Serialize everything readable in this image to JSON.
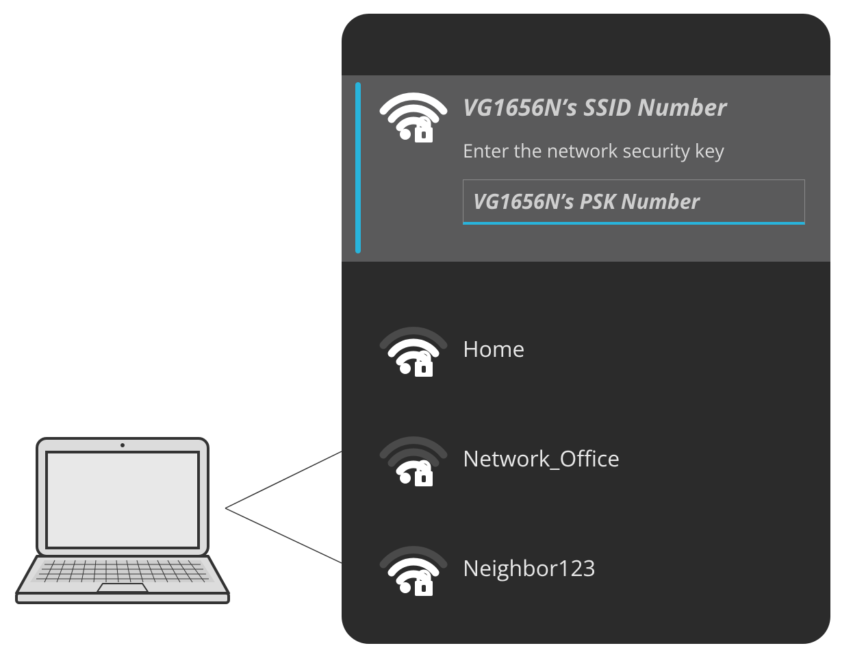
{
  "colors": {
    "panel_bg": "#2b2b2b",
    "selected_bg": "#5a5a5b",
    "accent": "#28b4dc",
    "text_light": "#e8e8e8",
    "text_dim": "#cfcfcf"
  },
  "selected_network": {
    "ssid_label": "VG1656N’s SSID Number",
    "prompt": "Enter the network security key",
    "psk_value": "VG1656N’s PSK Number",
    "signal_bars": 4,
    "secured": true
  },
  "other_networks": [
    {
      "name": "Home",
      "signal_bars": 3,
      "secured": true
    },
    {
      "name": "Network_Office",
      "signal_bars": 2,
      "secured": true
    },
    {
      "name": "Neighbor123",
      "signal_bars": 3,
      "secured": true
    }
  ]
}
